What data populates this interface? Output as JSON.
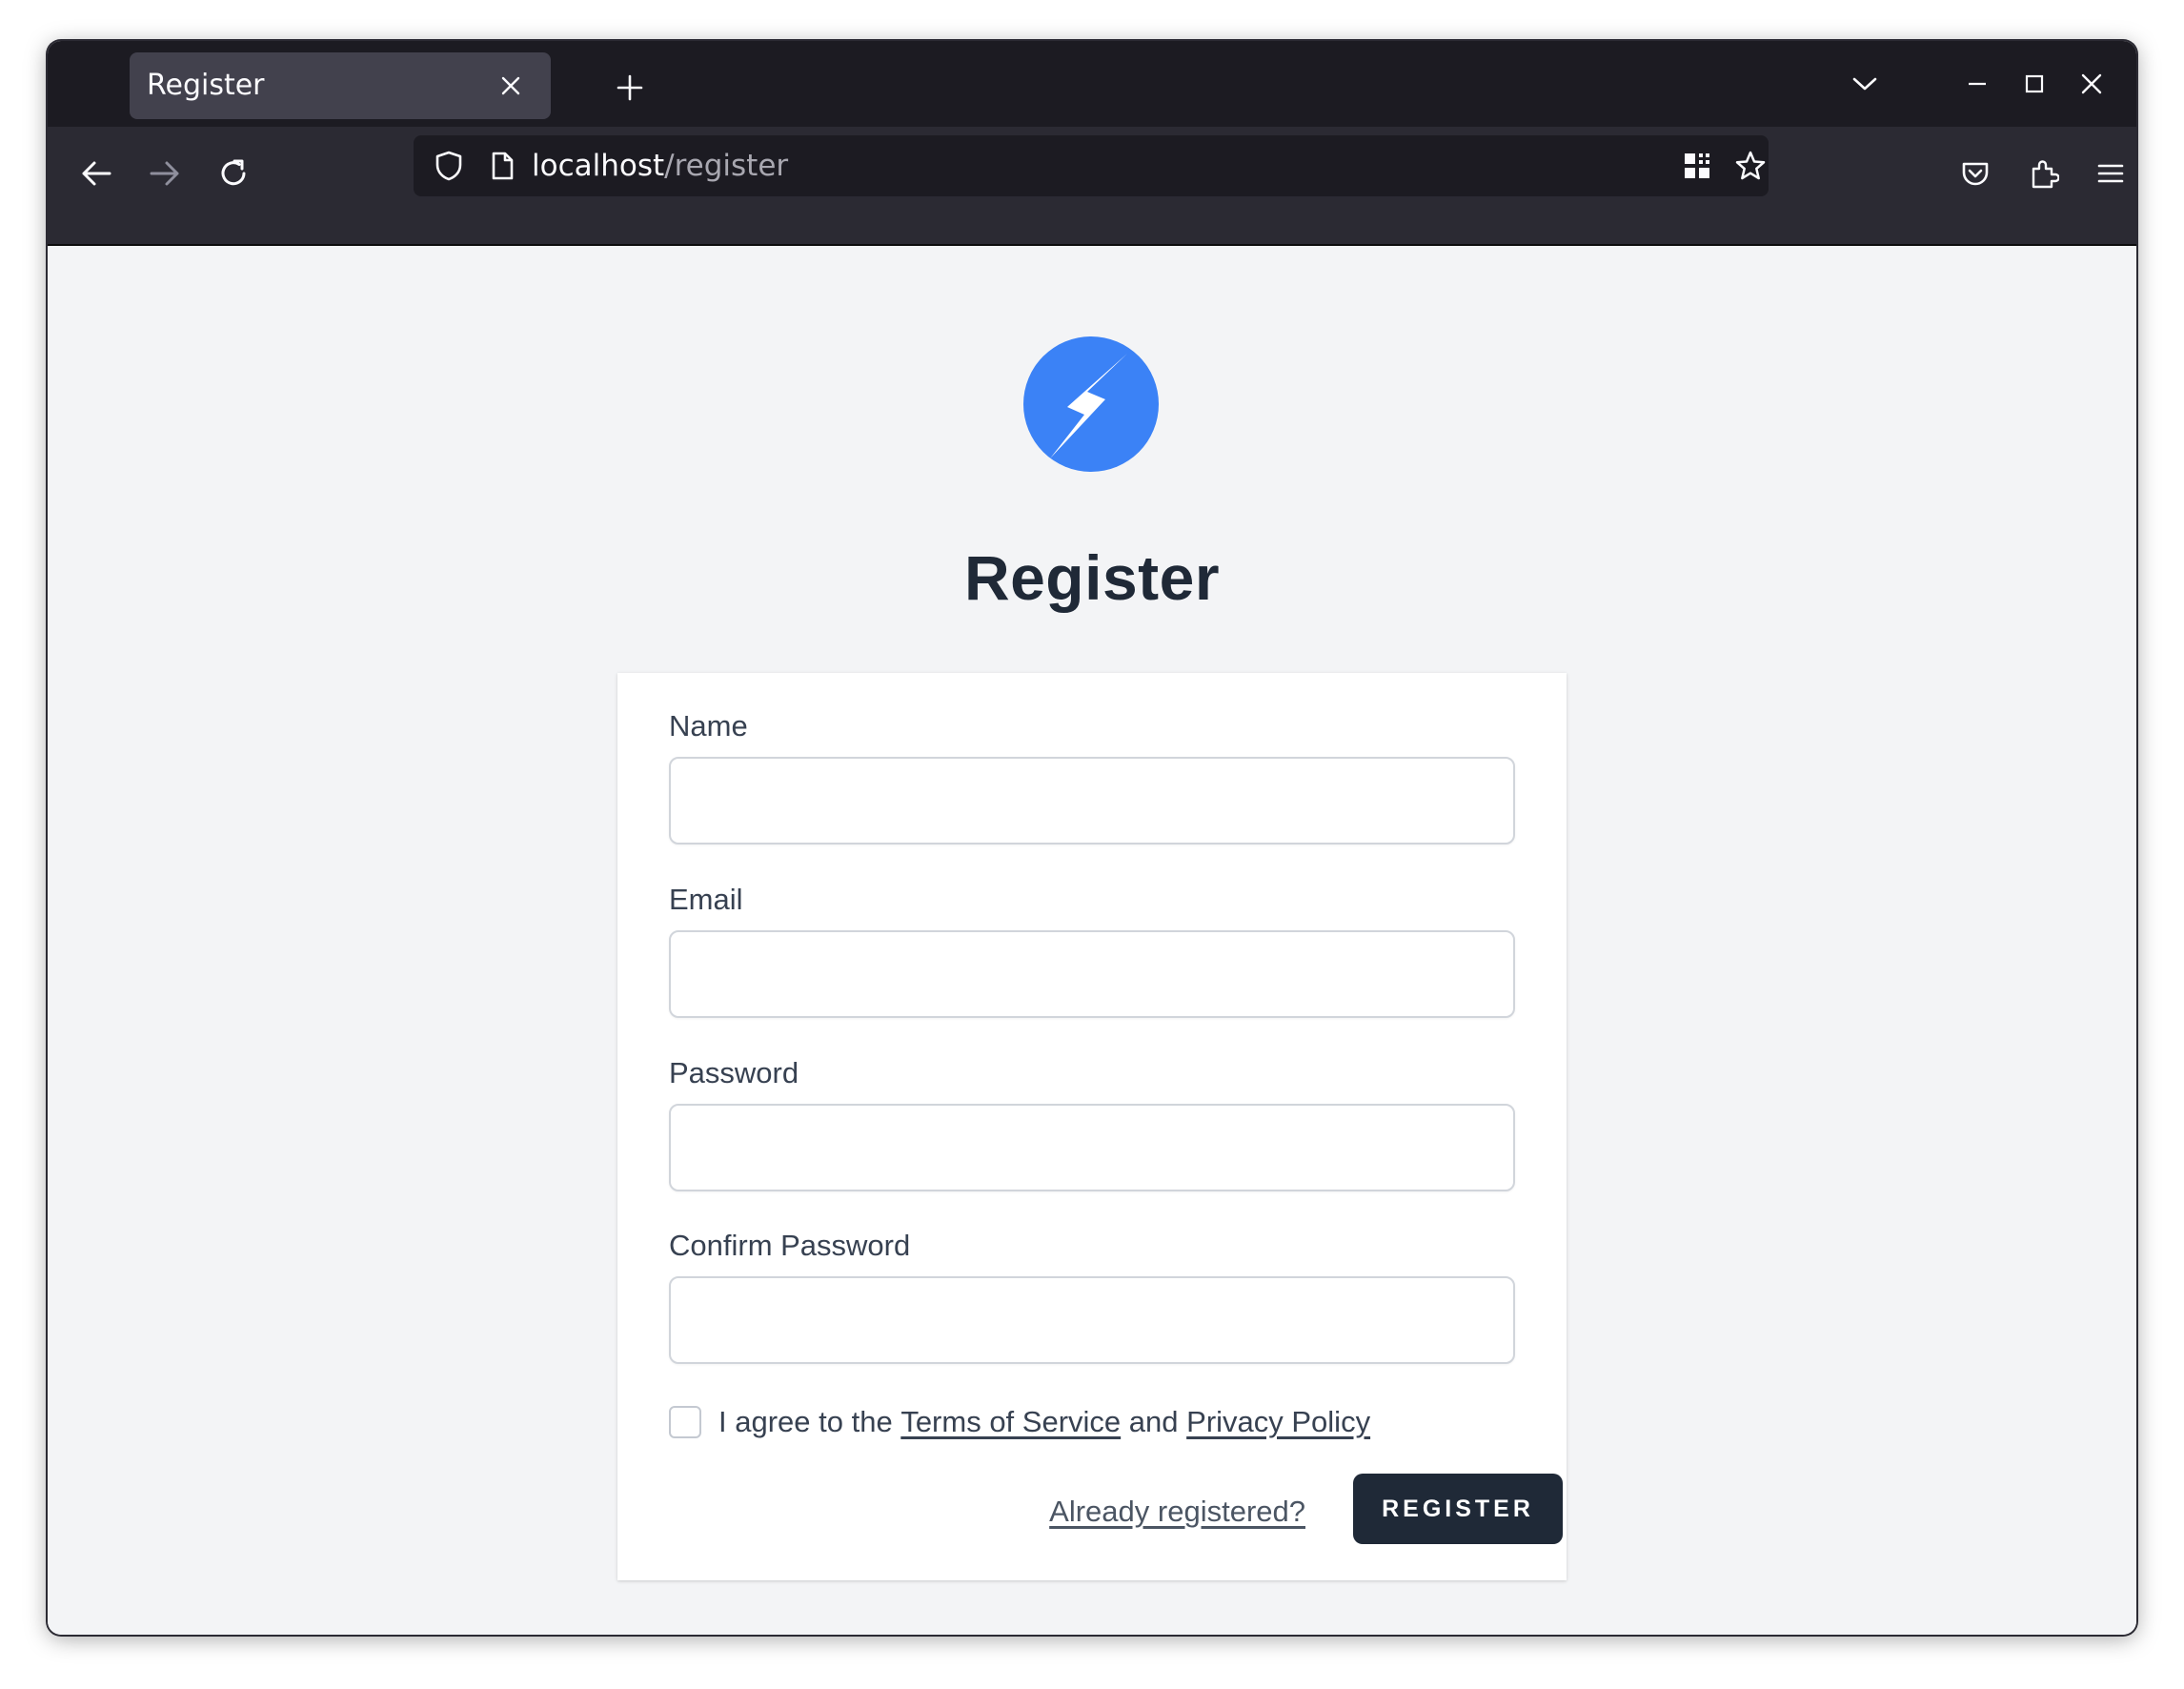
{
  "browser": {
    "tab": {
      "title": "Register"
    },
    "url": {
      "host": "localhost",
      "path": "/register"
    },
    "icons": {
      "tab_close": "close-icon",
      "new_tab": "plus-icon",
      "tab_list": "chevron-down-icon",
      "minimize": "minimize-icon",
      "maximize": "maximize-icon",
      "close": "close-icon",
      "back": "arrow-left-icon",
      "forward": "arrow-right-icon",
      "reload": "reload-icon",
      "tracking": "shield-icon",
      "page_info": "page-icon",
      "qr": "qr-code-icon",
      "bookmark": "star-icon",
      "pocket": "pocket-icon",
      "extensions": "puzzle-icon",
      "menu": "hamburger-menu-icon"
    }
  },
  "page": {
    "logo": "lightning-bolt-logo",
    "title": "Register",
    "form": {
      "name_label": "Name",
      "name_value": "",
      "email_label": "Email",
      "email_value": "",
      "password_label": "Password",
      "password_value": "",
      "confirm_password_label": "Confirm Password",
      "confirm_password_value": "",
      "terms": {
        "checked": false,
        "prefix": "I agree to the",
        "tos_link": "Terms of Service",
        "conjunction": "and",
        "privacy_link": "Privacy Policy"
      },
      "login_link": "Already registered?",
      "submit_label": "REGISTER"
    }
  },
  "colors": {
    "page_background": "#f3f4f6",
    "logo_blue": "#3b82f6",
    "button_dark": "#1f2937",
    "browser_chrome": "#2b2a33"
  }
}
